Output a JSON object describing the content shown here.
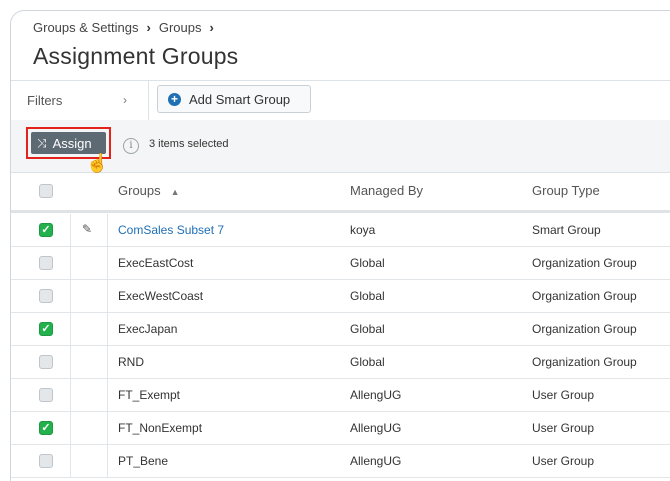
{
  "breadcrumb": {
    "items": [
      "Groups & Settings",
      "Groups"
    ],
    "separator": "›"
  },
  "page": {
    "title": "Assignment Groups"
  },
  "filters": {
    "label": "Filters",
    "add_smart_group_label": "Add Smart Group"
  },
  "actions": {
    "assign_label": "Assign",
    "selected_text": "3 items selected"
  },
  "table": {
    "headers": {
      "groups": "Groups",
      "managed_by": "Managed By",
      "group_type": "Group Type"
    },
    "rows": [
      {
        "group": "ComSales Subset 7",
        "managed_by": "koya",
        "group_type": "Smart Group",
        "checked": true,
        "editable": true
      },
      {
        "group": "ExecEastCost",
        "managed_by": "Global",
        "group_type": "Organization Group",
        "checked": false,
        "editable": false
      },
      {
        "group": "ExecWestCoast",
        "managed_by": "Global",
        "group_type": "Organization Group",
        "checked": false,
        "editable": false
      },
      {
        "group": "ExecJapan",
        "managed_by": "Global",
        "group_type": "Organization Group",
        "checked": true,
        "editable": false
      },
      {
        "group": "RND",
        "managed_by": "Global",
        "group_type": "Organization Group",
        "checked": false,
        "editable": false
      },
      {
        "group": "FT_Exempt",
        "managed_by": "AllengUG",
        "group_type": "User Group",
        "checked": false,
        "editable": false
      },
      {
        "group": "FT_NonExempt",
        "managed_by": "AllengUG",
        "group_type": "User Group",
        "checked": true,
        "editable": false
      },
      {
        "group": "PT_Bene",
        "managed_by": "AllengUG",
        "group_type": "User Group",
        "checked": false,
        "editable": false
      }
    ]
  },
  "colors": {
    "accent": "#1f6fb5",
    "checked": "#22b14c",
    "highlight_outline": "#e3221b",
    "assign_button": "#5e6a73"
  },
  "icons": {
    "info": "info-icon",
    "pencil": "pencil-icon",
    "shuffle": "shuffle-icon",
    "plus": "plus-circle-icon",
    "cursor": "hand-cursor-icon"
  }
}
